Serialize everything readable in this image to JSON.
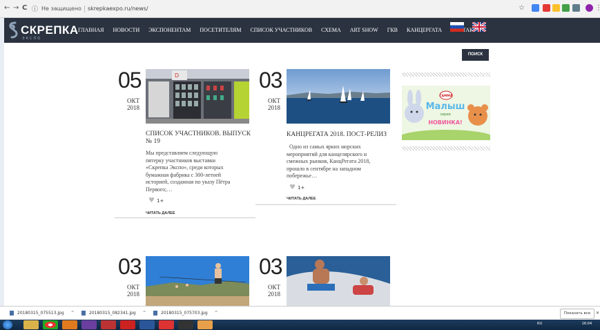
{
  "browser": {
    "security_label": "Не защищено",
    "url": "skrepkaexpo.ru/news/",
    "nav_back": "←",
    "nav_fwd": "→",
    "reload": "C",
    "info": "ⓘ",
    "star": "☆",
    "menu": "⋮"
  },
  "site": {
    "logo_text": "СКРЕПКА",
    "logo_sub": "ЭКСПО",
    "menu": [
      "ГЛАВНАЯ",
      "НОВОСТИ",
      "ЭКСПОНЕНТАМ",
      "ПОСЕТИТЕЛЯМ",
      "СПИСОК УЧАСТНИКОВ",
      "СХЕМА",
      "ART SHOW",
      "ГКВ",
      "КАНЦЕРГАТА",
      "КОНТАКТЫ"
    ],
    "search_label": "ПОИСК"
  },
  "posts": [
    {
      "day": "05",
      "month": "ОКТ",
      "year": "2018",
      "title": "СПИСОК УЧАСТНИКОВ. ВЫПУСК № 19",
      "title_l1": "СПИСОК УЧАСТНИКОВ. ВЫПУСК",
      "title_l2": "№ 19",
      "excerpt_lines": [
        "Мы представляем следующую",
        "пятерку участников выставки",
        "«Скрепка Экспо», среди которых",
        "бумажная фабрика с 300-летней",
        "историей, созданная по указу Пётра",
        "Первого;…"
      ],
      "likes": "1+",
      "read_more": "ЧИТАТЬ ДАЛЕЕ"
    },
    {
      "day": "03",
      "month": "ОКТ",
      "year": "2018",
      "title": "КАНЦРЕГАТА 2018. ПОСТ-РЕЛИЗ",
      "excerpt_lines": [
        "  Одно из самых ярких морских",
        "мероприятий для канцелярского и",
        "смежных рынков, КанцРегата 2018,",
        "прошло в сентябре на западном",
        "побережье…"
      ],
      "likes": "1+",
      "read_more": "ЧИТАТЬ ДАЛЕЕ"
    },
    {
      "day": "03",
      "month": "ОКТ",
      "year": "2018"
    },
    {
      "day": "03",
      "month": "ОКТ",
      "year": "2018"
    }
  ],
  "banner": {
    "brand": "ГАММА",
    "title": "Малыш",
    "subtitle": "серия",
    "new": "НОВИНКА!"
  },
  "downloads": [
    {
      "name": "20180315_075513.jpg"
    },
    {
      "name": "20180315_082341.jpg"
    },
    {
      "name": "20180315_075703.jpg"
    }
  ],
  "downloads_show_all": "Показать все",
  "downloads_close": "✕",
  "tray": {
    "lang": "RU",
    "time": "16:04"
  },
  "colors": {
    "header": "#2b3340",
    "accent": "#2b3340"
  }
}
